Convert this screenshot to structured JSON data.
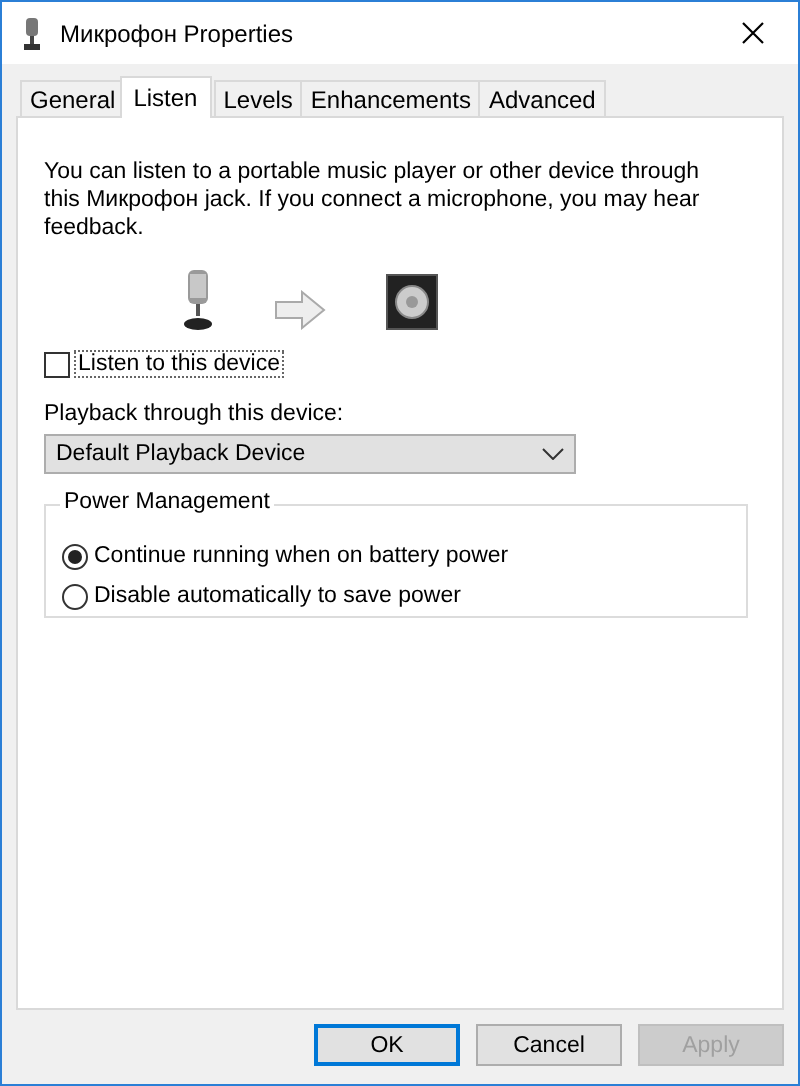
{
  "window": {
    "title": "Микрофон Properties"
  },
  "tabs": [
    {
      "label": "General",
      "selected": false
    },
    {
      "label": "Listen",
      "selected": true
    },
    {
      "label": "Levels",
      "selected": false
    },
    {
      "label": "Enhancements",
      "selected": false
    },
    {
      "label": "Advanced",
      "selected": false
    }
  ],
  "description": "You can listen to a portable music player or other device through this Микрофон jack.  If you connect a microphone, you may hear feedback.",
  "listen_checkbox": {
    "label": "Listen to this device",
    "checked": false
  },
  "playback": {
    "label": "Playback through this device:",
    "value": "Default Playback Device"
  },
  "power_management": {
    "title": "Power Management",
    "options": [
      {
        "label": "Continue running when on battery power",
        "selected": true
      },
      {
        "label": "Disable automatically to save power",
        "selected": false
      }
    ]
  },
  "buttons": [
    {
      "label": "OK",
      "kind": "default",
      "disabled": false
    },
    {
      "label": "Cancel",
      "kind": "normal",
      "disabled": false
    },
    {
      "label": "Apply",
      "kind": "normal",
      "disabled": true
    }
  ]
}
